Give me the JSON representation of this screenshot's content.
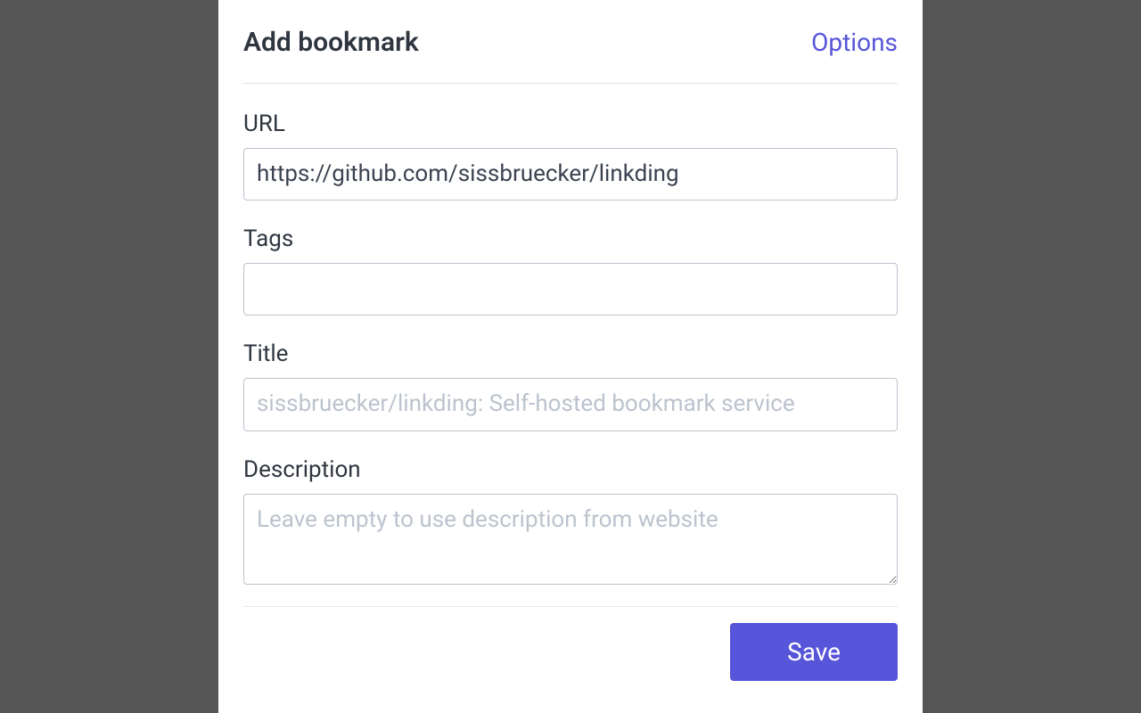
{
  "header": {
    "title": "Add bookmark",
    "options_link": "Options"
  },
  "form": {
    "url": {
      "label": "URL",
      "value": "https://github.com/sissbruecker/linkding"
    },
    "tags": {
      "label": "Tags",
      "value": ""
    },
    "title": {
      "label": "Title",
      "placeholder": "sissbruecker/linkding: Self-hosted bookmark service",
      "value": ""
    },
    "description": {
      "label": "Description",
      "placeholder": "Leave empty to use description from website",
      "value": ""
    }
  },
  "actions": {
    "save_label": "Save"
  }
}
